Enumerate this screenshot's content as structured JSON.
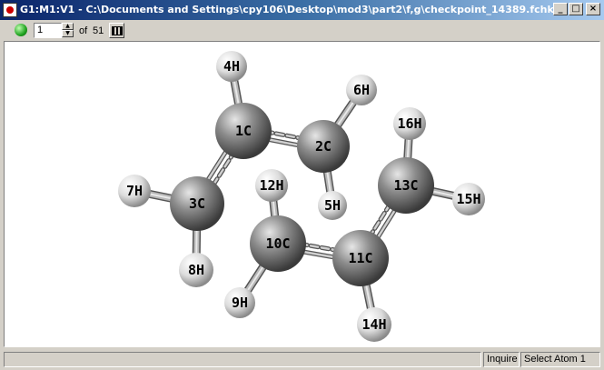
{
  "window": {
    "title": "G1:M1:V1 - C:\\Documents and Settings\\cpy106\\Desktop\\mod3\\part2\\f,g\\checkpoint_14389.fchk",
    "minimize_label": "_",
    "maximize_label": "□",
    "close_label": "×"
  },
  "toolbar": {
    "frame_value": "1",
    "of_label": "of",
    "frame_total": "51",
    "spin_up": "▲",
    "spin_down": "▼"
  },
  "molecule": {
    "carbon_color": "#7a7a7a",
    "hydrogen_color": "#e8e8e8",
    "atoms": [
      {
        "label": "1C",
        "type": "C"
      },
      {
        "label": "2C",
        "type": "C"
      },
      {
        "label": "3C",
        "type": "C"
      },
      {
        "label": "4H",
        "type": "H"
      },
      {
        "label": "5H",
        "type": "H"
      },
      {
        "label": "6H",
        "type": "H"
      },
      {
        "label": "7H",
        "type": "H"
      },
      {
        "label": "8H",
        "type": "H"
      },
      {
        "label": "9H",
        "type": "H"
      },
      {
        "label": "10C",
        "type": "C"
      },
      {
        "label": "11C",
        "type": "C"
      },
      {
        "label": "12H",
        "type": "H"
      },
      {
        "label": "13C",
        "type": "C"
      },
      {
        "label": "14H",
        "type": "H"
      },
      {
        "label": "15H",
        "type": "H"
      },
      {
        "label": "16H",
        "type": "H"
      }
    ]
  },
  "statusbar": {
    "mode_label": "Inquire",
    "action_label": "Select Atom 1"
  }
}
